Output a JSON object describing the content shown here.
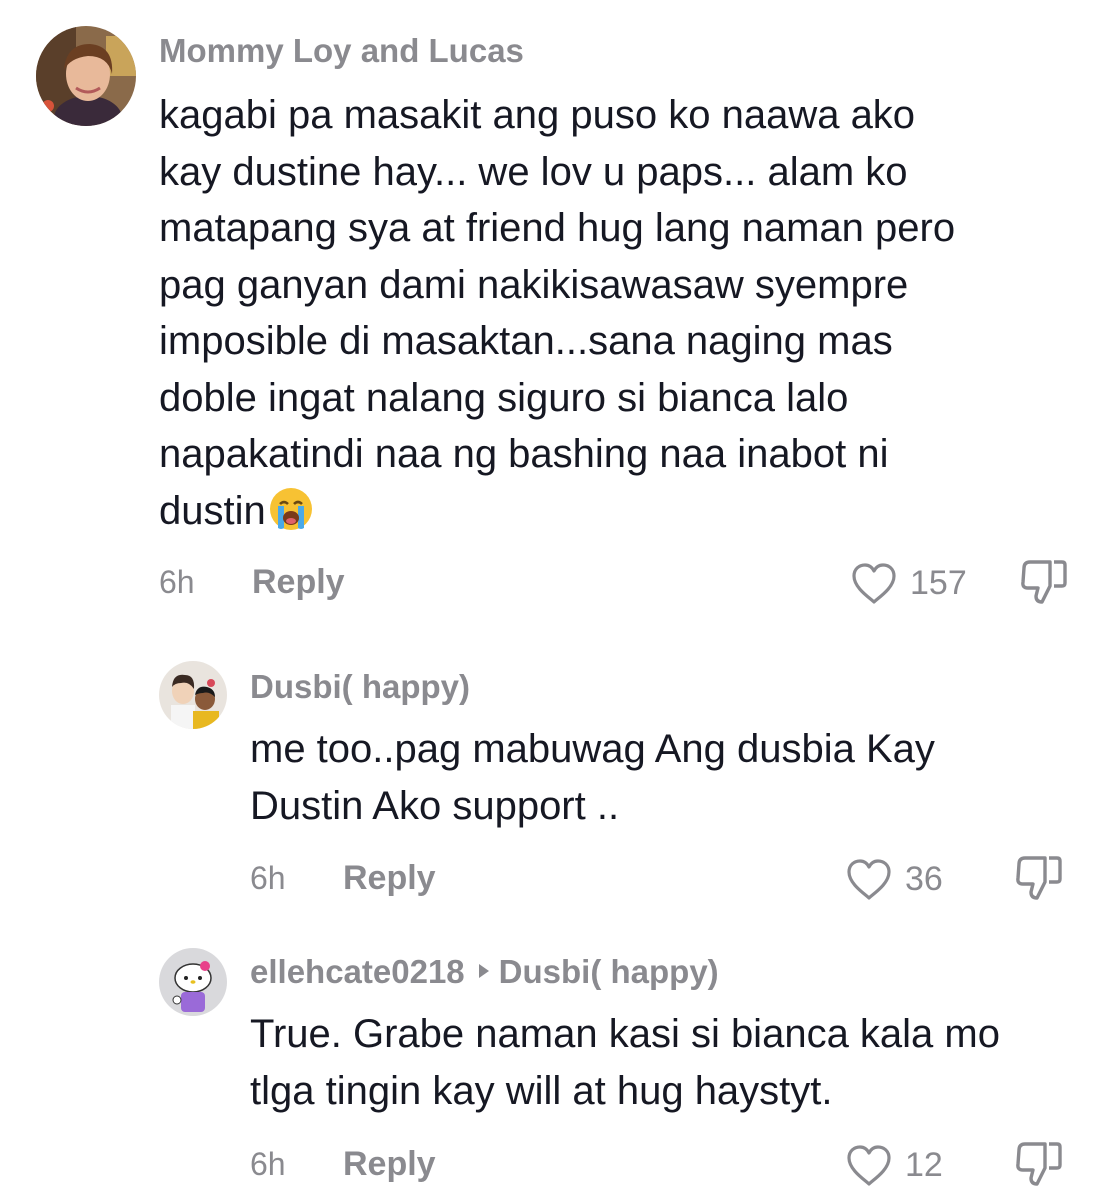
{
  "comments": [
    {
      "username": "Mommy Loy and Lucas",
      "text_lines": [
        "kagabi pa masakit ang puso ko naawa ako",
        "kay dustine hay... we lov u paps... alam ko",
        "matapang sya at friend hug lang naman pero",
        "pag ganyan dami nakikisawasaw syempre",
        "imposible di masaktan...sana naging mas",
        "doble ingat nalang siguro si bianca lalo",
        "napakatindi naa ng bashing naa inabot ni",
        "dustin"
      ],
      "emoji": "loudly-crying-face",
      "time": "6h",
      "reply_label": "Reply",
      "likes": "157"
    },
    {
      "username": "Dusbi( happy)",
      "text_lines": [
        "me too..pag mabuwag Ang dusbia Kay",
        "Dustin Ako support .."
      ],
      "time": "6h",
      "reply_label": "Reply",
      "likes": "36"
    },
    {
      "username": "ellehcate0218",
      "reply_to": "Dusbi( happy)",
      "text_lines": [
        "True. Grabe naman kasi si bianca kala mo",
        "tlga tingin kay will at hug haystyt."
      ],
      "time": "6h",
      "reply_label": "Reply",
      "likes": "12"
    }
  ],
  "icons": {
    "like": "heart-outline-icon",
    "dislike": "thumbs-down-icon",
    "reply_to": "reply-arrow-icon"
  },
  "colors": {
    "text": "#161823",
    "muted": "#8a8a8f",
    "background": "#ffffff"
  }
}
